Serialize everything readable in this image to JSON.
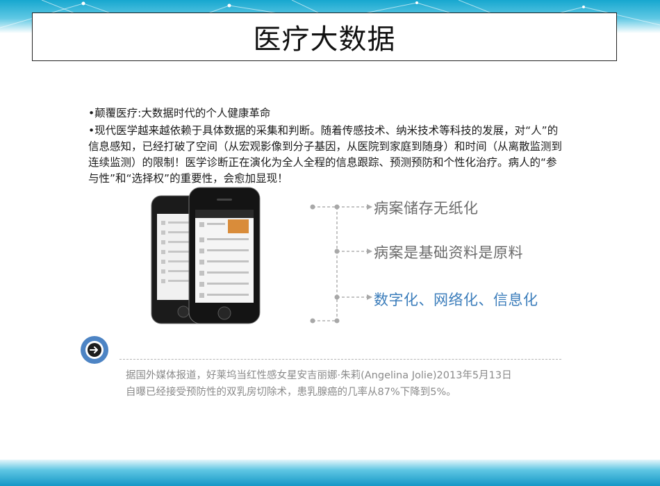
{
  "slide": {
    "title": "医疗大数据",
    "bullets": [
      "•颠覆医疗:大数据时代的个人健康革命",
      "•现代医学越来越依赖于具体数据的采集和判断。随着传感技术、纳米技术等科技的发展，对“人”的信息感知，已经打破了空间（从宏观影像到分子基因，从医院到家庭到随身）和时间（从离散监测到连续监测）的限制！医学诊断正在演化为全人全程的信息跟踪、预测预防和个性化治疗。病人的“参与性”和“选择权”的重要性，会愈加显现！"
    ],
    "items": [
      {
        "text": "病案储存无纸化",
        "color": "#6b6b6b"
      },
      {
        "text": "病案是基础资料是原料",
        "color": "#6b6b6b"
      },
      {
        "text": "数字化、网络化、信息化",
        "color": "#3b7dbb"
      }
    ],
    "note_lines": [
      "据国外媒体报道，好莱坞当红性感女星安吉丽娜·朱莉(Angelina Jolie)2013年5月13日",
      "自曝已经接受预防性的双乳房切除术，患乳腺癌的几率从87%下降到5%。"
    ]
  },
  "colors": {
    "accent_blue": "#3b7dbb",
    "button_blue": "#4d84c4",
    "banner": "#17a7cf"
  },
  "icons": {
    "nav_button": "arrow-right-circle-icon"
  }
}
